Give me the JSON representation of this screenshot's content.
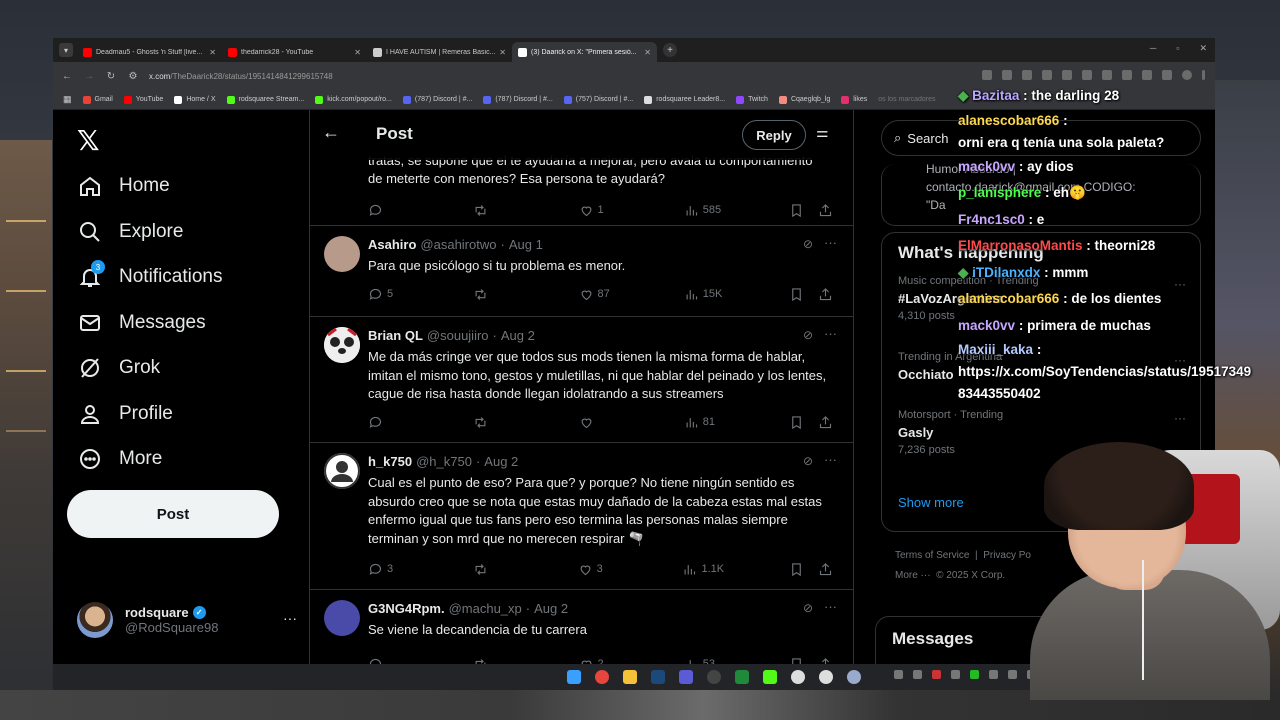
{
  "browser": {
    "tabs": [
      {
        "title": "Deadmau5 - Ghosts 'n Stuff [live...",
        "favicon_color": "#ff0000",
        "active": false
      },
      {
        "title": "thedarrick28 - YouTube",
        "favicon_color": "#ff0000",
        "active": false
      },
      {
        "title": "I HAVE AUTISM | Remeras Basic...",
        "favicon_color": "#cccccc",
        "active": false
      },
      {
        "title": "(3) Daarick on X: \"Primera sesió...",
        "favicon_color": "#ffffff",
        "active": true
      }
    ],
    "url_host": "x.com",
    "url_path": "/TheDaarick28/status/1951414841299615748",
    "bookmarks": [
      {
        "label": "Gmail",
        "color": "#ea4335"
      },
      {
        "label": "YouTube",
        "color": "#ff0000"
      },
      {
        "label": "Home / X",
        "color": "#ffffff"
      },
      {
        "label": "rodsquaree Stream...",
        "color": "#53fc18"
      },
      {
        "label": "kick.com/popout/ro...",
        "color": "#53fc18"
      },
      {
        "label": "(787) Discord | #...",
        "color": "#5865f2"
      },
      {
        "label": "(787) Discord | #...",
        "color": "#5865f2"
      },
      {
        "label": "(757) Discord | #...",
        "color": "#5865f2"
      },
      {
        "label": "rodsquaree Leader8...",
        "color": "#dddddd"
      },
      {
        "label": "Twitch",
        "color": "#9146ff"
      },
      {
        "label": "Cqaeglqb_lg",
        "color": "#f28b82"
      },
      {
        "label": "likes",
        "color": "#e1306c"
      }
    ],
    "bookmarks_overflow": "os los marcadores"
  },
  "nav": {
    "items": [
      {
        "label": "Home",
        "icon": "home-icon"
      },
      {
        "label": "Explore",
        "icon": "search-icon"
      },
      {
        "label": "Notifications",
        "icon": "bell-icon",
        "badge": "3"
      },
      {
        "label": "Messages",
        "icon": "mail-icon"
      },
      {
        "label": "Grok",
        "icon": "grok-icon"
      },
      {
        "label": "Profile",
        "icon": "person-icon"
      },
      {
        "label": "More",
        "icon": "more-circle-icon"
      }
    ],
    "post_label": "Post",
    "account": {
      "name": "rodsquare",
      "handle": "@RodSquare98"
    }
  },
  "header": {
    "title": "Post",
    "reply_label": "Reply"
  },
  "partial_tweet": {
    "text": "tratas, se supone que el te ayudaría a mejorar, pero avala tu comportamiento de meterte con menores? Esa persona te ayudará?",
    "replies": "",
    "retweets": "",
    "likes": "1",
    "views": "585"
  },
  "tweets": [
    {
      "name": "Asahiro",
      "handle": "@asahirotwo",
      "date": "Aug 1",
      "text": "Para que psicólogo si tu problema es menor.",
      "replies": "5",
      "retweets": "",
      "likes": "87",
      "views": "15K",
      "avatar_color": "#b89a8a"
    },
    {
      "name": "Brian QL",
      "handle": "@souujiiro",
      "date": "Aug 2",
      "text": "Me da más cringe ver que todos sus mods tienen la misma forma de hablar, imitan el mismo tono, gestos y muletillas, ni que hablar del peinado y los lentes, cague de risa hasta donde llegan idolatrando a sus streamers",
      "replies": "",
      "retweets": "",
      "likes": "",
      "views": "81",
      "avatar_color": "#eeeeee"
    },
    {
      "name": "h_k750",
      "handle": "@h_k750",
      "date": "Aug 2",
      "text": "Cual es el punto de eso? Para que? y porque? No tiene ningún sentido es absurdo creo que se nota que estas muy dañado de la cabeza estas mal estas enfermo igual que tus fans pero eso termina las personas malas siempre terminan y son mrd que no merecen respirar 🫗",
      "replies": "3",
      "retweets": "",
      "likes": "3",
      "views": "1.1K",
      "avatar_color": "#cfd9de"
    },
    {
      "name": "G3NG4Rpm.",
      "handle": "@machu_xp",
      "date": "Aug 2",
      "text": "Se viene la decandencia de tu carrera",
      "replies": "",
      "retweets": "",
      "likes": "2",
      "views": "53",
      "avatar_color": "#4a4aa8"
    }
  ],
  "right": {
    "search_placeholder": "Search",
    "promo_lines": [
      "Humor Absurdo |",
      "contacto.daarick@gmail.com CODIGO:",
      "\"Da"
    ],
    "trends_title": "What's happening",
    "trends": [
      {
        "context": "Music competition · Trending",
        "topic": "#LaVozArgentina",
        "count": "4,310 posts"
      },
      {
        "context": "Trending in Argentina",
        "topic": "Occhiato",
        "count": ""
      },
      {
        "context": "Motorsport · Trending",
        "topic": "Gasly",
        "count": "7,236 posts"
      }
    ],
    "show_more": "Show more",
    "footer_links": [
      "Terms of Service",
      "|",
      "Privacy Po"
    ],
    "footer_more": "More ···",
    "copyright": "© 2025 X Corp.",
    "messages_title": "Messages"
  },
  "chat": [
    {
      "user": "Bazitaa",
      "color": "#b9a7ff",
      "message": "the darling 28",
      "badge": "#4caf50"
    },
    {
      "user": "alanescobar666",
      "color": "#ffd84d",
      "message": "orni era q tenía una sola paleta?"
    },
    {
      "user": "mack0vv",
      "color": "#c7a6ff",
      "message": "ay dios"
    },
    {
      "user": "p_lanisphere",
      "color": "#4cff4c",
      "message": "eh🤫"
    },
    {
      "user": "Fr4nc1sc0",
      "color": "#c9a6ff",
      "message": "e"
    },
    {
      "user": "ElMarronasoMantis",
      "color": "#ff4a4a",
      "message": "theorni28"
    },
    {
      "user": "iTDilanxdx",
      "color": "#4ab3ff",
      "message": "mmm",
      "badge": "#4caf50"
    },
    {
      "user": "alanescobar666",
      "color": "#ffd84d",
      "message": "de los dientes"
    },
    {
      "user": "mack0vv",
      "color": "#c7a6ff",
      "message": "primera de muchas"
    },
    {
      "user": "Maxiii_kaka",
      "color": "#b3c9ff",
      "message": "https://x.com/SoyTendencias/status/1951734983443550402"
    }
  ]
}
